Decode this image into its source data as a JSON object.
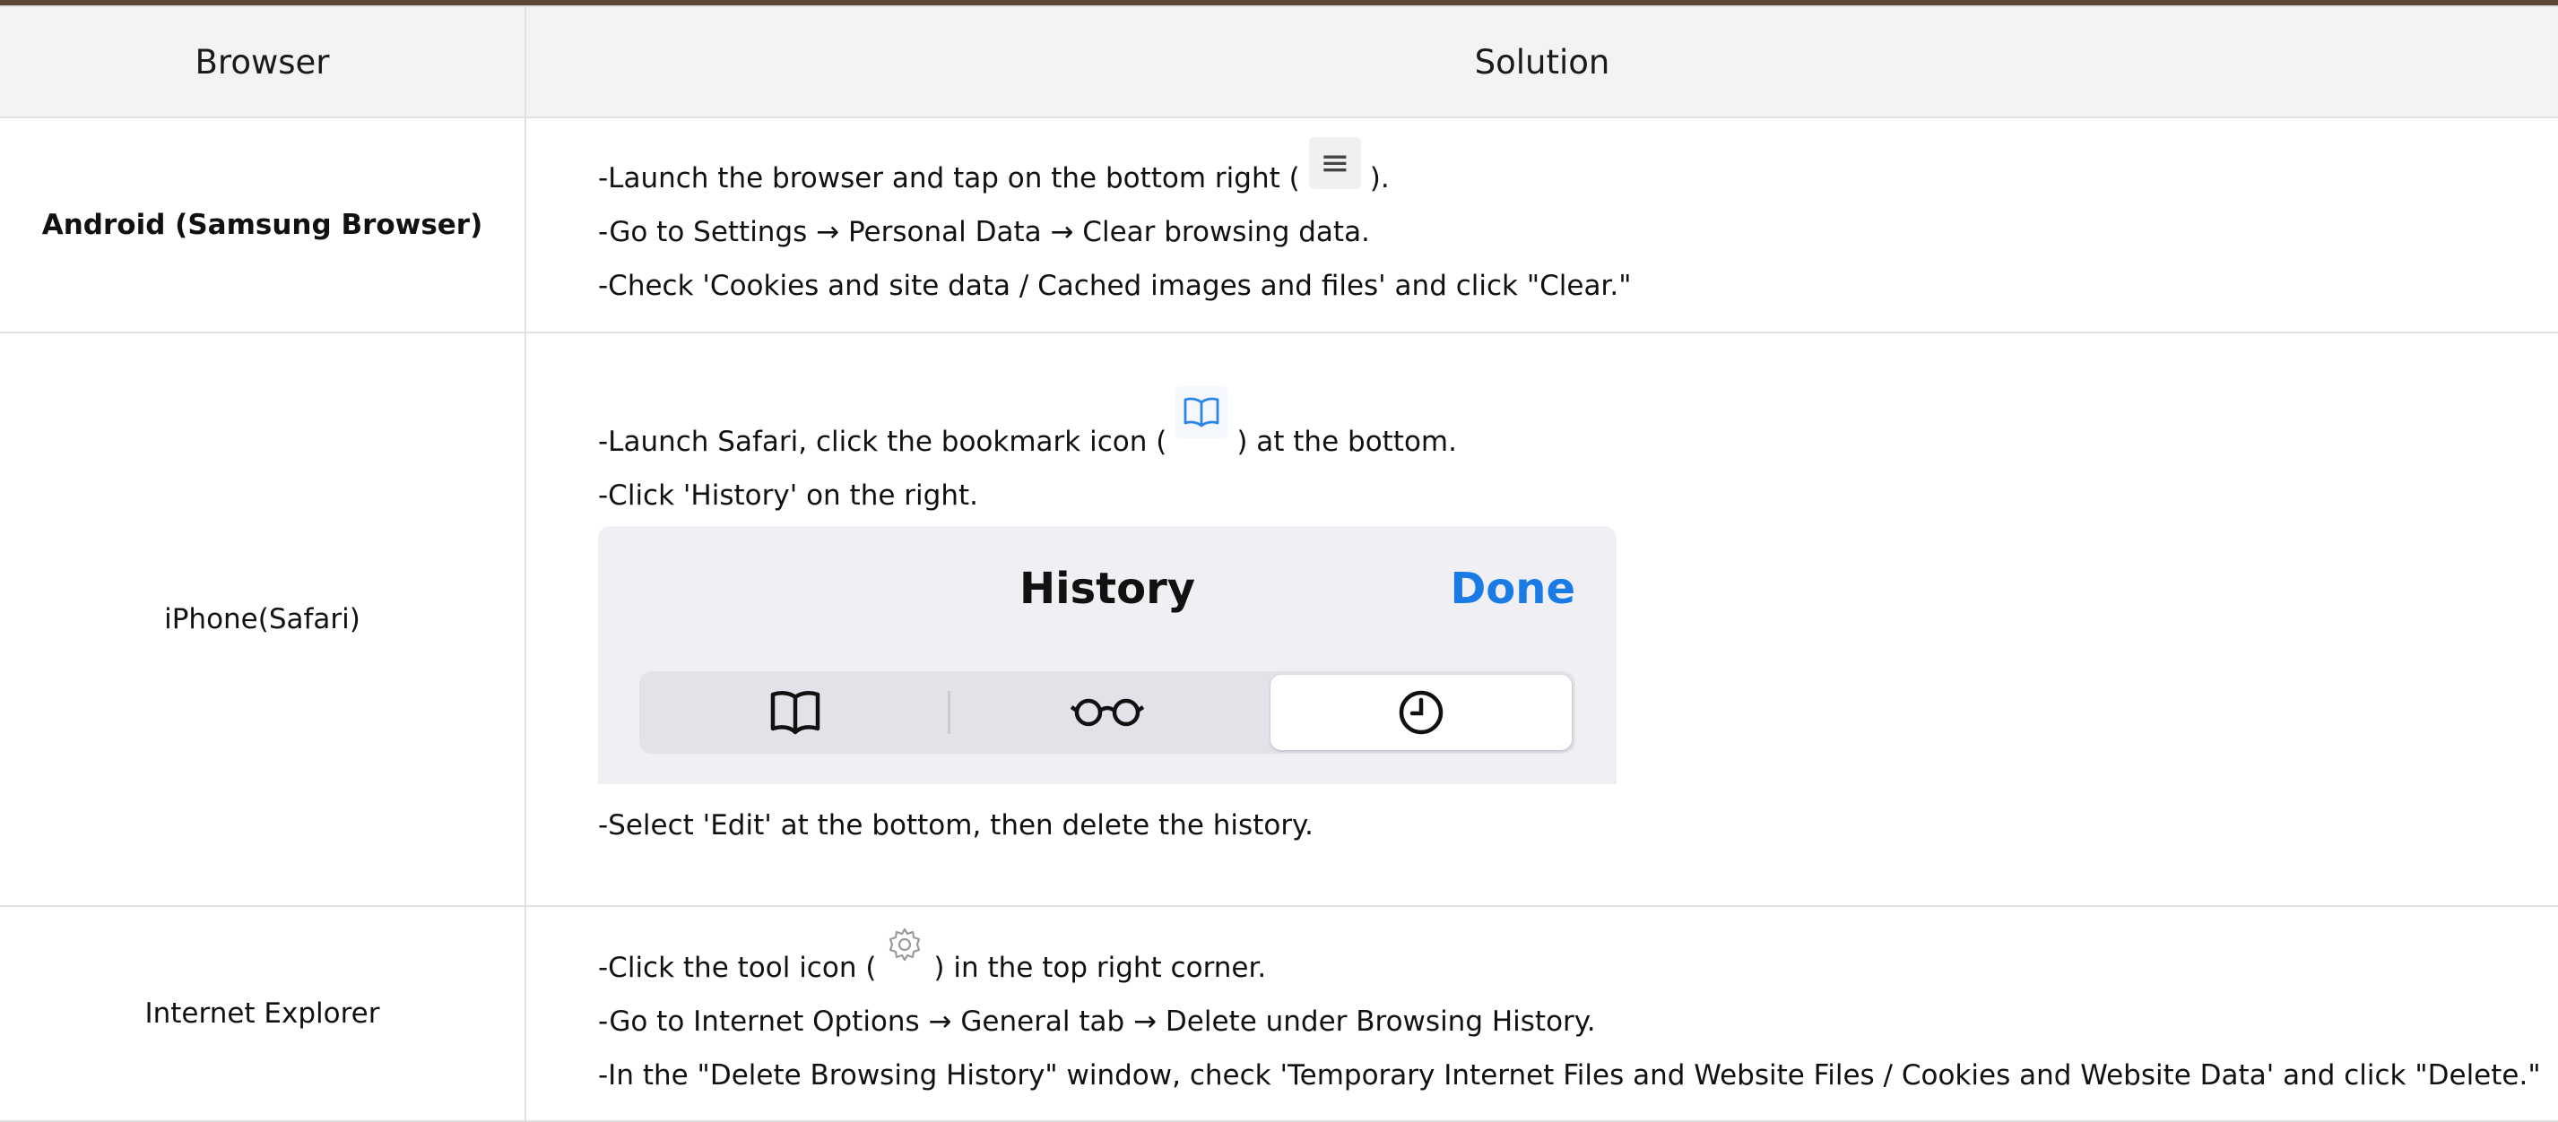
{
  "table": {
    "header": {
      "browser": "Browser",
      "solution": "Solution"
    },
    "rows": [
      {
        "browser": "Android (Samsung Browser)",
        "lines": [
          {
            "before": "-Launch the browser and tap on the bottom right (",
            "after": ")."
          },
          {
            "text": "-Go to Settings → Personal Data → Clear browsing data."
          },
          {
            "text": "-Check 'Cookies and site data / Cached images and files' and click \"Clear.\""
          }
        ],
        "icon": "menu-icon"
      },
      {
        "browser": "iPhone(Safari)",
        "lines": [
          {
            "before": "-Launch Safari, click the bookmark icon (",
            "after": ") at the bottom."
          },
          {
            "text": "-Click 'History' on the right."
          },
          {
            "text": "-Select 'Edit' at the bottom, then delete the history."
          }
        ],
        "icon": "book-icon",
        "history_panel": {
          "title": "History",
          "done": "Done",
          "tabs": [
            "book-icon",
            "glasses-icon",
            "clock-icon"
          ],
          "active_tab": "clock-icon"
        }
      },
      {
        "browser": "Internet Explorer",
        "lines": [
          {
            "before": "-Click the tool icon (",
            "after": ") in the top right corner."
          },
          {
            "text": "-Go to Internet Options → General tab → Delete under Browsing History."
          },
          {
            "text": "-In the \"Delete Browsing History\" window, check 'Temporary Internet Files and Website Files / Cookies and Website Data' and click \"Delete.\""
          }
        ],
        "icon": "gear-icon"
      }
    ]
  },
  "colors": {
    "accent_bar": "#5a4636",
    "done_blue": "#1a7ae6",
    "header_bg": "#f3f3f3"
  }
}
